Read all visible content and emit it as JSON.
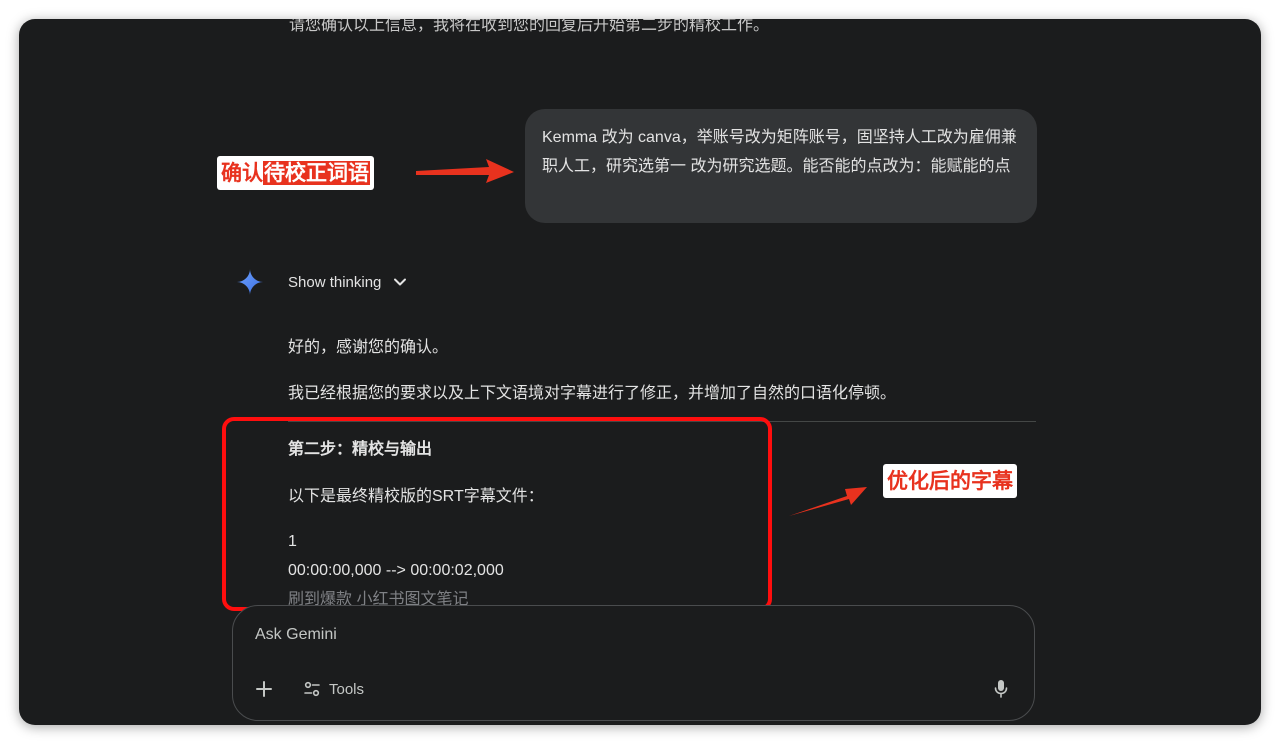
{
  "previous_message_fragment": "请您确认以上信息，我将在收到您的回复后开始第二步的精校工作。",
  "user_message": "Kemma 改为 canva，举账号改为矩阵账号，固坚持人工改为雇佣兼职人工，研究选第一 改为研究选题。能否能的点改为：能赋能的点",
  "annotations": {
    "confirm_prefix": "确认",
    "confirm_highlight": "待校正词语",
    "optimized": "优化后的字幕"
  },
  "response": {
    "show_thinking_label": "Show thinking",
    "paragraph_1": "好的，感谢您的确认。",
    "paragraph_2": "我已经根据您的要求以及上下文语境对字幕进行了修正，并增加了自然的口语化停顿。",
    "step_title": "第二步：精校与输出",
    "intro": "以下是最终精校版的SRT字幕文件：",
    "srt_index": "1",
    "srt_timestamp": "00:00:00,000 --> 00:00:02,000",
    "srt_text": "刷到爆款 小红书图文笔记"
  },
  "input": {
    "placeholder": "Ask Gemini",
    "tools_label": "Tools",
    "icons": [
      "plus-icon",
      "tools-icon",
      "mic-icon"
    ]
  },
  "colors": {
    "window_bg": "#1b1c1d",
    "bubble_bg": "#333537",
    "annotation_red": "#e8321e",
    "highlight_box": "#ff0e0e",
    "gemini_blue": "#4f86f7"
  }
}
